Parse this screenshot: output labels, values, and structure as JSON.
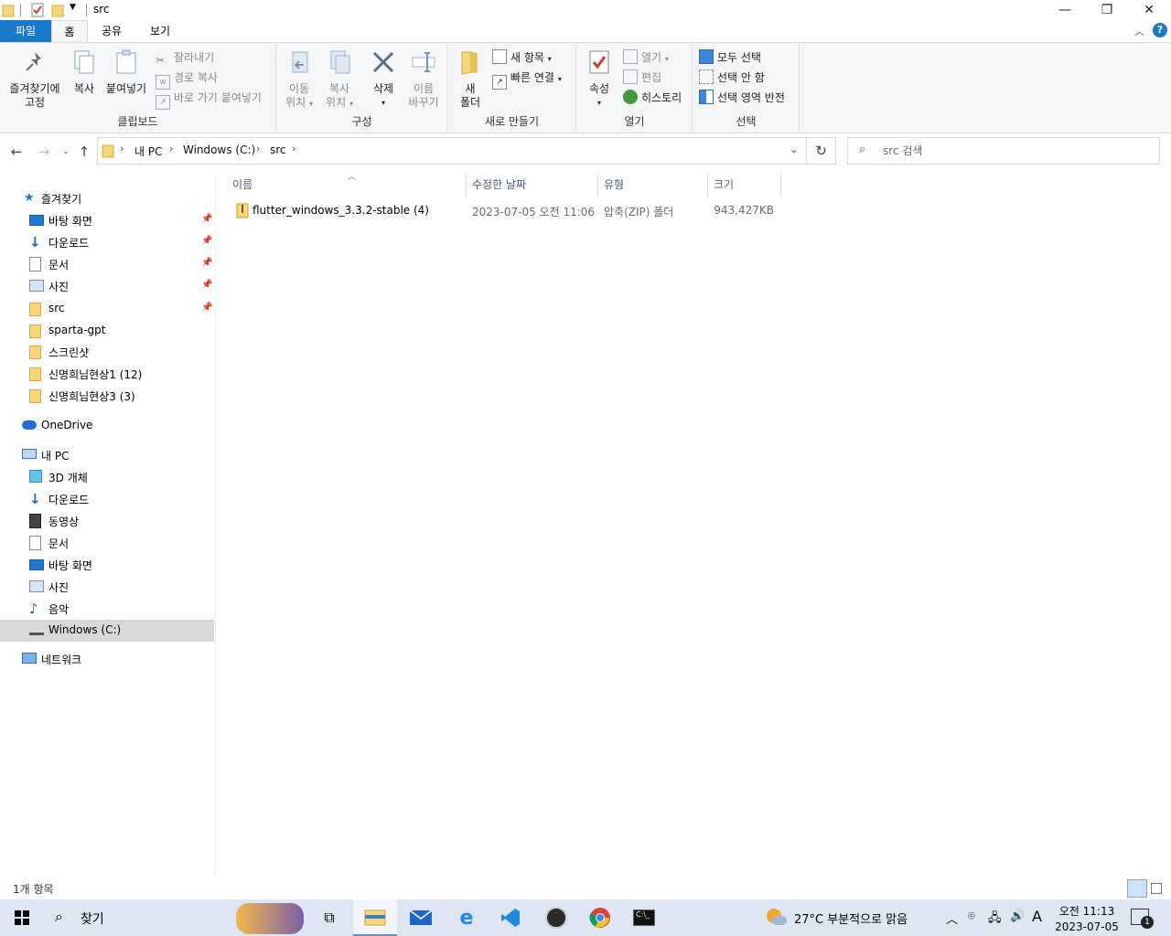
{
  "window": {
    "title": "src",
    "minimize_icon": "minimize-icon",
    "maximize_icon": "restore-icon",
    "close_icon": "close-icon"
  },
  "ribbon_tabs": {
    "file": "파일",
    "home": "홈",
    "share": "공유",
    "view": "보기"
  },
  "ribbon": {
    "clipboard": {
      "label": "클립보드",
      "pin_line1": "즐겨찾기에",
      "pin_line2": "고정",
      "copy": "복사",
      "paste": "붙여넣기",
      "cut": "잘라내기",
      "copy_path": "경로 복사",
      "paste_shortcut": "바로 가기 붙여넣기"
    },
    "organize": {
      "label": "구성",
      "move_line1": "이동",
      "move_line2": "위치",
      "copy_line1": "복사",
      "copy_line2": "위치",
      "delete": "삭제",
      "rename_line1": "이름",
      "rename_line2": "바꾸기"
    },
    "new": {
      "label": "새로 만들기",
      "folder_line1": "새",
      "folder_line2": "폴더",
      "new_item": "새 항목",
      "easy_access": "빠른 연결"
    },
    "open": {
      "label": "열기",
      "properties": "속성",
      "open": "열기",
      "edit": "편집",
      "history": "히스토리"
    },
    "select": {
      "label": "선택",
      "select_all": "모두 선택",
      "select_none": "선택 안 함",
      "invert": "선택 영역 반전"
    }
  },
  "address": {
    "crumbs": [
      "내 PC",
      "Windows (C:)",
      "src"
    ],
    "search_placeholder": "src 검색"
  },
  "nav": {
    "quick_access": "즐겨찾기",
    "quick_items": [
      {
        "label": "바탕 화면",
        "icon": "desktop-icon",
        "pinned": true
      },
      {
        "label": "다운로드",
        "icon": "download-icon",
        "pinned": true
      },
      {
        "label": "문서",
        "icon": "document-icon",
        "pinned": true
      },
      {
        "label": "사진",
        "icon": "pictures-icon",
        "pinned": true
      },
      {
        "label": "src",
        "icon": "folder-icon",
        "pinned": true
      },
      {
        "label": "sparta-gpt",
        "icon": "folder-icon",
        "pinned": false
      },
      {
        "label": "스크린샷",
        "icon": "folder-icon",
        "pinned": false
      },
      {
        "label": "신명희님현상1 (12)",
        "icon": "folder-icon",
        "pinned": false
      },
      {
        "label": "신명희님현상3 (3)",
        "icon": "folder-icon",
        "pinned": false
      }
    ],
    "onedrive": "OneDrive",
    "this_pc": "내 PC",
    "pc_items": [
      {
        "label": "3D 개체",
        "icon": "3d-objects-icon"
      },
      {
        "label": "다운로드",
        "icon": "download-icon"
      },
      {
        "label": "동영상",
        "icon": "video-icon"
      },
      {
        "label": "문서",
        "icon": "document-icon"
      },
      {
        "label": "바탕 화면",
        "icon": "desktop-icon"
      },
      {
        "label": "사진",
        "icon": "pictures-icon"
      },
      {
        "label": "음악",
        "icon": "music-icon"
      },
      {
        "label": "Windows (C:)",
        "icon": "drive-icon"
      }
    ],
    "network": "네트워크"
  },
  "files": {
    "columns": {
      "name": "이름",
      "modified": "수정한 날짜",
      "type": "유형",
      "size": "크기"
    },
    "rows": [
      {
        "name": "flutter_windows_3.3.2-stable (4)",
        "modified": "2023-07-05 오전 11:06",
        "type": "압축(ZIP) 폴더",
        "size": "943,427KB"
      }
    ]
  },
  "status": {
    "item_count": "1개 항목"
  },
  "taskbar": {
    "search_label": "찾기",
    "weather": "27°C  부분적으로 맑음",
    "ime": "A",
    "time": "오전 11:13",
    "date": "2023-07-05",
    "notification_count": "1"
  },
  "colors": {
    "accent": "#1979ca",
    "folder": "#f8d775",
    "taskbar": "#dde6f2"
  }
}
